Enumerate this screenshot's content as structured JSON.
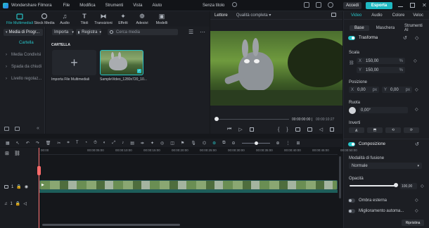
{
  "app": {
    "name": "Wondershare Filmora",
    "project_title": "Senza titolo"
  },
  "menu": [
    "File",
    "Modifica",
    "Strumenti",
    "Vista",
    "Aiuto"
  ],
  "header_buttons": {
    "login": "Accedi",
    "export": "Esporta"
  },
  "toolbar_tabs": [
    "File Multimediali",
    "Stock Media",
    "Audio",
    "Titoli",
    "Transizioni",
    "Effetti",
    "Adesivi",
    "Modelli"
  ],
  "media": {
    "sidebar_title": "Media di Progr...",
    "folder_selected": "Cartella",
    "sidebar_items": [
      "Media Condivisi",
      "Spada da chiudi",
      "Livello regolaz..."
    ],
    "import_btn": "Importa",
    "record_btn": "Registra",
    "search_placeholder": "Cerca media",
    "folder_label": "CARTELLA",
    "import_tile_label": "Importa File Multimediali",
    "clip_label": "SampleVideo_1280x720_10..."
  },
  "player": {
    "tab_left": "Lettore",
    "quality": "Qualità completa",
    "time_current": "00:00:00:00",
    "time_total": "00:00:10:27"
  },
  "inspector": {
    "top_tabs": [
      "Video",
      "Audio",
      "Colore",
      "Veloc"
    ],
    "sub_tabs": [
      "Base",
      "Maschera",
      "Strumenti AI"
    ],
    "transform_label": "Trasforma",
    "scale_label": "Scala",
    "scale_x_label": "X",
    "scale_x": "150,00",
    "scale_y_label": "Y",
    "scale_y": "150,00",
    "unit_pct": "%",
    "position_label": "Posizione",
    "pos_x_label": "X",
    "pos_x": "0,00",
    "pos_y_label": "Y",
    "pos_y": "0,00",
    "unit_px": "px",
    "rotate_label": "Ruota",
    "rotate_val": "0,00°",
    "flip_label": "Inverti",
    "composite_label": "Composizione",
    "blend_label": "Modalità di fusione",
    "blend_val": "Normale",
    "opacity_label": "Opacità",
    "opacity_val": "100,00",
    "opacity_fraction": 1.0,
    "shadow_label": "Ombra esterna",
    "enhance_label": "Miglioramento automa...",
    "reset_btn": "Ripristina"
  },
  "timeline": {
    "ticks": [
      "00:00",
      "00:00:05:00",
      "00:00:10:00",
      "00:00:15:00",
      "00:00:20:00",
      "00:00:25:00",
      "00:00:30:00",
      "00:00:35:00",
      "00:00:40:00",
      "00:00:45:00",
      "00:00:50:00"
    ],
    "track_video_label": "1",
    "track_audio_label": "1"
  },
  "colors": {
    "accent": "#27c3c7",
    "export_bg": "#1fb8c1",
    "panel": "#1c1e23",
    "bg": "#15171b"
  }
}
